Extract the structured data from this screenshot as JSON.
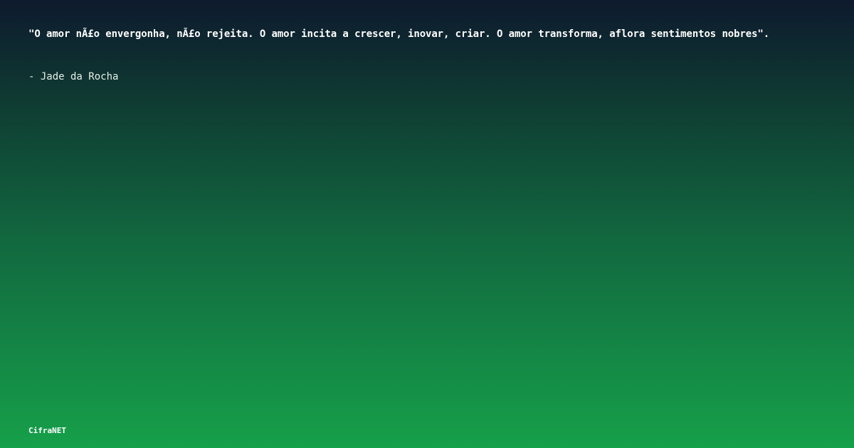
{
  "quote": {
    "text": "\"O amor nÃ£o envergonha, nÃ£o rejeita. O amor incita a crescer, inovar, criar. O amor transforma, aflora sentimentos nobres\".",
    "author": "- Jade da Rocha"
  },
  "brand": {
    "name": "CifraNET"
  },
  "colors": {
    "gradient_top": "#0e1a2e",
    "gradient_bottom": "#16a04a",
    "text": "#ffffff"
  }
}
